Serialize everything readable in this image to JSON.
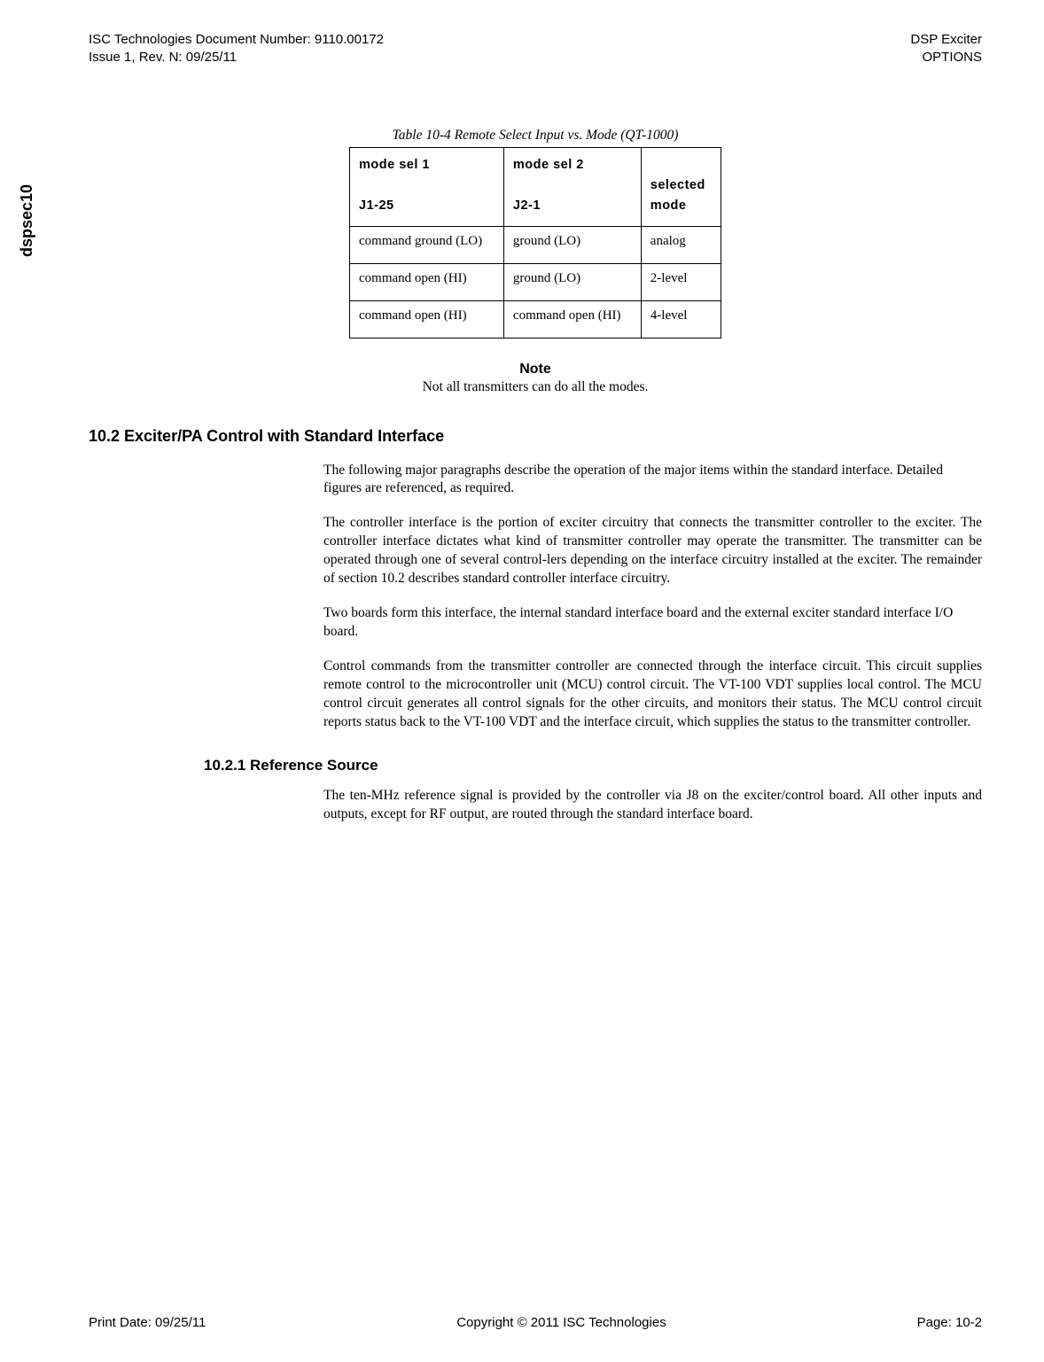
{
  "header": {
    "doc_number_label": "ISC Technologies Document Number: 9110.00172",
    "issue_rev": "Issue 1, Rev. N: 09/25/11",
    "product": "DSP Exciter",
    "section": "OPTIONS"
  },
  "side_tab": "dspsec10",
  "table": {
    "caption": "Table 10-4 Remote Select Input vs. Mode (QT-1000)",
    "headers": {
      "col1_line1": "mode sel 1",
      "col1_line2": "J1-25",
      "col2_line1": "mode sel 2",
      "col2_line2": "J2-1",
      "col3_line1": "selected",
      "col3_line2": "mode"
    },
    "rows": [
      {
        "c1": "command ground (LO)",
        "c2": "ground (LO)",
        "c3": "analog"
      },
      {
        "c1": "command open (HI)",
        "c2": "ground (LO)",
        "c3": "2-level"
      },
      {
        "c1": "command open (HI)",
        "c2": "command open (HI)",
        "c3": "4-level"
      }
    ]
  },
  "note": {
    "title": "Note",
    "text": "Not all transmitters can do all the modes."
  },
  "section_10_2": {
    "heading": "10.2 Exciter/PA Control with Standard Interface",
    "p1": "The following major paragraphs describe the operation of the major items within the standard interface. Detailed figures are referenced, as required.",
    "p2": "The controller interface is the portion of exciter circuitry that connects the transmitter controller to the exciter. The controller interface dictates what kind of transmitter controller may operate the transmitter. The transmitter can be operated through one of several control-lers depending on the interface circuitry installed at the exciter. The remainder of section 10.2 describes standard controller interface circuitry.",
    "p3": "Two boards form this interface, the internal standard interface board and the external exciter standard interface I/O board.",
    "p4": "Control commands from the transmitter controller are connected through the interface circuit. This circuit supplies remote control to the microcontroller unit (MCU) control circuit. The VT-100 VDT supplies local control. The MCU control circuit generates all control signals for the other circuits, and monitors their status. The MCU control circuit reports status back to the VT-100 VDT and the interface circuit, which supplies the status to the transmitter controller."
  },
  "section_10_2_1": {
    "heading": "10.2.1 Reference Source",
    "p1": "The ten-MHz reference signal is provided by the controller via J8 on the exciter/control board. All other inputs and outputs, except for RF output, are routed through the standard interface board."
  },
  "footer": {
    "print_date": "Print Date: 09/25/11",
    "copyright": "Copyright © 2011 ISC Technologies",
    "page": "Page: 10-2"
  }
}
